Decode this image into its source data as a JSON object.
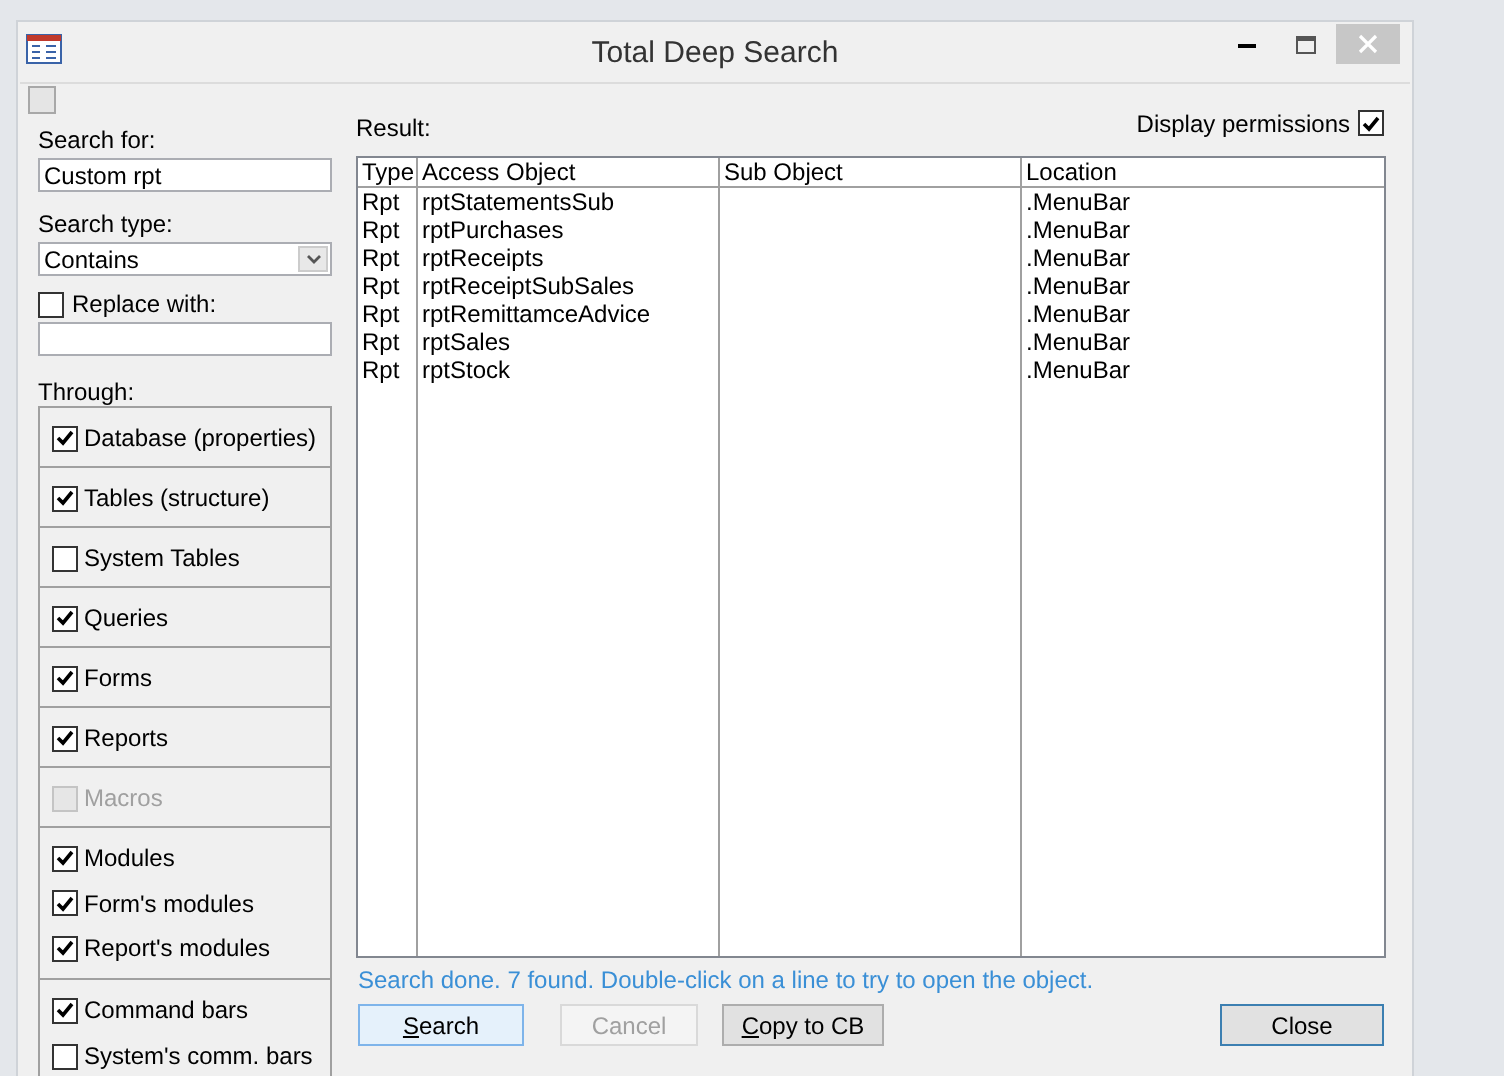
{
  "window": {
    "title": "Total Deep Search"
  },
  "top_checkbox": {
    "checked": false
  },
  "search_for": {
    "label": "Search for:",
    "value": "Custom rpt"
  },
  "search_type": {
    "label": "Search type:",
    "value": "Contains"
  },
  "replace": {
    "label": "Replace with:",
    "checked": false
  },
  "through": {
    "label": "Through:",
    "groups": [
      [
        {
          "label": "Database (properties)",
          "checked": true,
          "disabled": false
        }
      ],
      [
        {
          "label": "Tables (structure)",
          "checked": true,
          "disabled": false
        }
      ],
      [
        {
          "label": "System Tables",
          "checked": false,
          "disabled": false
        }
      ],
      [
        {
          "label": "Queries",
          "checked": true,
          "disabled": false
        }
      ],
      [
        {
          "label": "Forms",
          "checked": true,
          "disabled": false
        }
      ],
      [
        {
          "label": "Reports",
          "checked": true,
          "disabled": false
        }
      ],
      [
        {
          "label": "Macros",
          "checked": false,
          "disabled": true
        }
      ],
      [
        {
          "label": "Modules",
          "checked": true,
          "disabled": false
        },
        {
          "label": "Form's modules",
          "checked": true,
          "disabled": false
        },
        {
          "label": "Report's modules",
          "checked": true,
          "disabled": false
        }
      ],
      [
        {
          "label": "Command bars",
          "checked": true,
          "disabled": false
        },
        {
          "label": "System's comm. bars",
          "checked": false,
          "disabled": false
        }
      ]
    ]
  },
  "result": {
    "label": "Result:",
    "display_permissions": {
      "label": "Display permissions",
      "checked": true
    },
    "columns": [
      "Type",
      "Access Object",
      "Sub Object",
      "Location"
    ],
    "rows": [
      [
        "Rpt",
        "rptStatementsSub",
        "",
        ".MenuBar"
      ],
      [
        "Rpt",
        "rptPurchases",
        "",
        ".MenuBar"
      ],
      [
        "Rpt",
        "rptReceipts",
        "",
        ".MenuBar"
      ],
      [
        "Rpt",
        "rptReceiptSubSales",
        "",
        ".MenuBar"
      ],
      [
        "Rpt",
        "rptRemittamceAdvice",
        "",
        ".MenuBar"
      ],
      [
        "Rpt",
        "rptSales",
        "",
        ".MenuBar"
      ],
      [
        "Rpt",
        "rptStock",
        "",
        ".MenuBar"
      ]
    ]
  },
  "status": "Search done. 7 found. Double-click on a line to try to open the object.",
  "buttons": [
    {
      "label": "Search",
      "kind": "default",
      "disabled": false,
      "mnemonic": true
    },
    {
      "label": "Cancel",
      "kind": "normal",
      "disabled": true,
      "mnemonic": false
    },
    {
      "label": "Copy to CB",
      "kind": "normal",
      "disabled": false,
      "mnemonic": true
    },
    {
      "label": "Close",
      "kind": "focused",
      "disabled": false,
      "mnemonic": false
    }
  ]
}
